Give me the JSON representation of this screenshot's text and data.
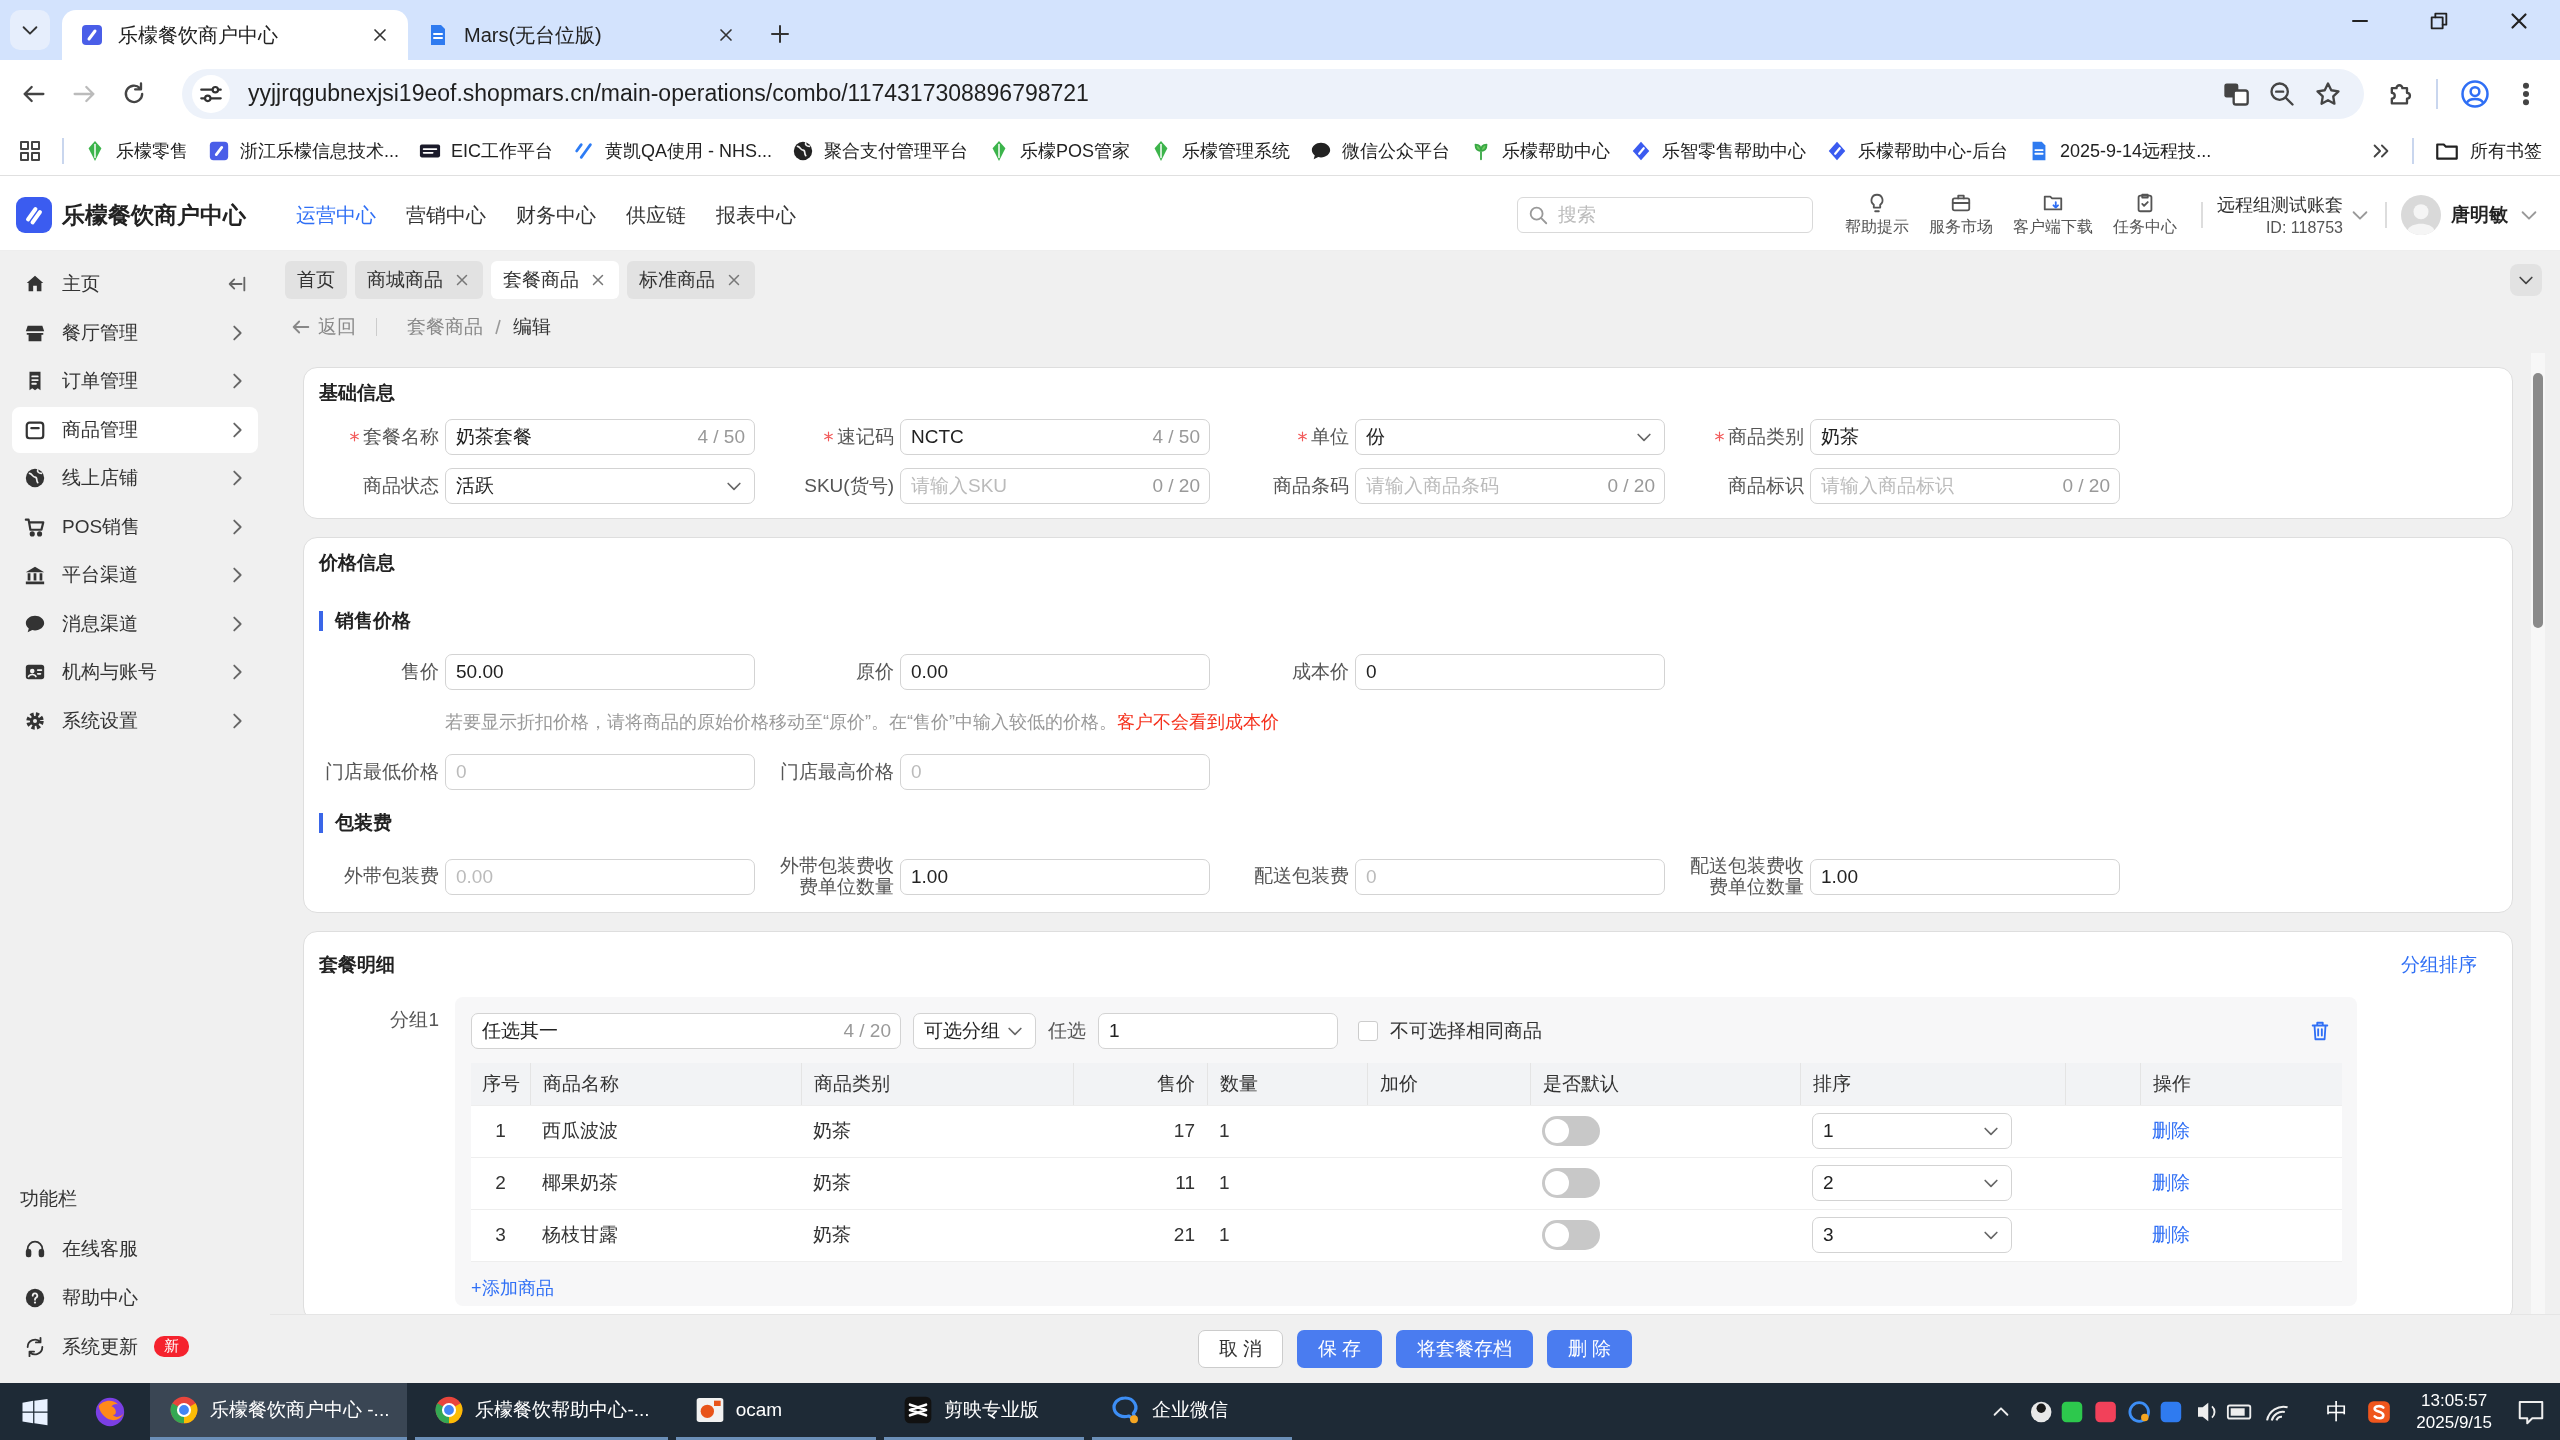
{
  "browser": {
    "tabs": [
      {
        "title": "乐檬餐饮商户中心",
        "selected": true
      },
      {
        "title": "Mars(无台位版)",
        "selected": false
      }
    ],
    "url": "yyjjrqgubnexjsi19eof.shopmars.cn/main-operations/combo/1174317308896798721",
    "bookmarks": [
      {
        "label": "乐檬零售"
      },
      {
        "label": "浙江乐檬信息技术..."
      },
      {
        "label": "EIC工作平台"
      },
      {
        "label": "黄凯QA使用 - NHS..."
      },
      {
        "label": "聚合支付管理平台"
      },
      {
        "label": "乐檬POS管家"
      },
      {
        "label": "乐檬管理系统"
      },
      {
        "label": "微信公众平台"
      },
      {
        "label": "乐檬帮助中心"
      },
      {
        "label": "乐智零售帮助中心"
      },
      {
        "label": "乐檬帮助中心-后台"
      },
      {
        "label": "2025-9-14远程技..."
      }
    ],
    "all_bookmarks": "所有书签"
  },
  "app": {
    "title": "乐檬餐饮商户中心",
    "nav": [
      {
        "label": "运营中心",
        "selected": true
      },
      {
        "label": "营销中心",
        "selected": false
      },
      {
        "label": "财务中心",
        "selected": false
      },
      {
        "label": "供应链",
        "selected": false
      },
      {
        "label": "报表中心",
        "selected": false
      }
    ],
    "search": {
      "placeholder": "搜索"
    },
    "tools": [
      {
        "label": "帮助提示"
      },
      {
        "label": "服务市场"
      },
      {
        "label": "客户端下载"
      },
      {
        "label": "任务中心"
      }
    ],
    "account": {
      "name": "远程组测试账套",
      "id": "ID: 118753"
    },
    "user": "唐明敏"
  },
  "sidebar": {
    "items": [
      {
        "label": "主页",
        "selected": false
      },
      {
        "label": "餐厅管理",
        "selected": false
      },
      {
        "label": "订单管理",
        "selected": false
      },
      {
        "label": "商品管理",
        "selected": true
      },
      {
        "label": "线上店铺",
        "selected": false
      },
      {
        "label": "POS销售",
        "selected": false
      },
      {
        "label": "平台渠道",
        "selected": false
      },
      {
        "label": "消息渠道",
        "selected": false
      },
      {
        "label": "机构与账号",
        "selected": false
      },
      {
        "label": "系统设置",
        "selected": false
      }
    ],
    "section_title": "功能栏",
    "functions": [
      {
        "label": "在线客服"
      },
      {
        "label": "帮助中心"
      },
      {
        "label": "系统更新",
        "badge": "新"
      }
    ]
  },
  "page_tabs": [
    {
      "label": "首页",
      "selected": false,
      "closable": false
    },
    {
      "label": "商城商品",
      "selected": false,
      "closable": true
    },
    {
      "label": "套餐商品",
      "selected": true,
      "closable": true
    },
    {
      "label": "标准商品",
      "selected": false,
      "closable": true
    }
  ],
  "breadcrumb": {
    "back": "返回",
    "path": [
      "套餐商品",
      "编辑"
    ]
  },
  "basic_info": {
    "title": "基础信息",
    "fields": [
      {
        "label": "套餐名称",
        "required": true,
        "kind": "input",
        "value": "奶茶套餐",
        "counter": "4 / 50"
      },
      {
        "label": "速记码",
        "required": true,
        "kind": "input",
        "value": "NCTC",
        "counter": "4 / 50"
      },
      {
        "label": "单位",
        "required": true,
        "kind": "select",
        "value": "份"
      },
      {
        "label": "商品类别",
        "required": true,
        "kind": "input",
        "value": "奶茶"
      },
      {
        "label": "商品状态",
        "required": false,
        "kind": "select",
        "value": "活跃"
      },
      {
        "label": "SKU(货号)",
        "required": false,
        "kind": "input",
        "placeholder": "请输入SKU",
        "counter": "0 / 20"
      },
      {
        "label": "商品条码",
        "required": false,
        "kind": "input",
        "placeholder": "请输入商品条码",
        "counter": "0 / 20"
      },
      {
        "label": "商品标识",
        "required": false,
        "kind": "input",
        "placeholder": "请输入商品标识",
        "counter": "0 / 20"
      }
    ]
  },
  "price_info": {
    "title": "价格信息",
    "sale": {
      "title": "销售价格",
      "fields": [
        {
          "label": "售价",
          "required": false,
          "kind": "input",
          "value": "50.00"
        },
        {
          "label": "原价",
          "required": false,
          "kind": "input",
          "value": "0.00"
        },
        {
          "label": "成本价",
          "required": false,
          "kind": "input",
          "value": "0"
        }
      ],
      "hint": {
        "text": "若要显示折扣价格，请将商品的原始价格移动至“原价”。在“售价”中输入较低的价格。",
        "warning": "客户不会看到成本价"
      },
      "store_fields": [
        {
          "label": "门店最低价格",
          "required": false,
          "kind": "input",
          "placeholder": "0"
        },
        {
          "label": "门店最高价格",
          "required": false,
          "kind": "input",
          "placeholder": "0"
        }
      ]
    },
    "packaging": {
      "title": "包装费",
      "fields": [
        {
          "label": "外带包装费",
          "required": false,
          "kind": "input",
          "placeholder": "0.00"
        },
        {
          "label": "外带包装费收费单位数量",
          "required": false,
          "kind": "input",
          "value": "1.00"
        },
        {
          "label": "配送包装费",
          "required": false,
          "kind": "input",
          "placeholder": "0"
        },
        {
          "label": "配送包装费收费单位数量",
          "required": false,
          "kind": "input",
          "value": "1.00"
        }
      ]
    }
  },
  "combo": {
    "title": "套餐明细",
    "sort_link": "分组排序",
    "groups": [
      {
        "label": "分组1",
        "name": "任选其一",
        "counter": "4 / 20",
        "mode": "可选分组",
        "pick_label": "任选",
        "pick": "1",
        "no_duplicates": {
          "label": "不可选择相同商品",
          "checked": false
        },
        "columns": [
          "序号",
          "商品名称",
          "商品类别",
          "售价",
          "数量",
          "加价",
          "是否默认",
          "排序",
          "操作"
        ],
        "items": [
          {
            "index": "1",
            "name": "西瓜波波",
            "category": "奶茶",
            "price": "17",
            "quantity": "1",
            "default": false,
            "sort": "1",
            "action": "删除"
          },
          {
            "index": "2",
            "name": "椰果奶茶",
            "category": "奶茶",
            "price": "11",
            "quantity": "1",
            "default": false,
            "sort": "2",
            "action": "删除"
          },
          {
            "index": "3",
            "name": "杨枝甘露",
            "category": "奶茶",
            "price": "21",
            "quantity": "1",
            "default": false,
            "sort": "3",
            "action": "删除"
          }
        ],
        "add_link": "+添加商品"
      }
    ]
  },
  "footer": {
    "buttons": [
      {
        "label": "取 消",
        "kind": "secondary"
      },
      {
        "label": "保 存",
        "kind": "primary"
      },
      {
        "label": "将套餐存档",
        "kind": "primary"
      },
      {
        "label": "删 除",
        "kind": "primary"
      }
    ]
  },
  "taskbar": {
    "items": [
      {
        "label": "乐檬餐饮商户中心 -...",
        "selected": true
      },
      {
        "label": "乐檬餐饮帮助中心-...",
        "selected": false
      },
      {
        "label": "ocam",
        "selected": false
      },
      {
        "label": "剪映专业版",
        "selected": false
      },
      {
        "label": "企业微信",
        "selected": false
      }
    ],
    "ime": "中",
    "time": "13:05:57",
    "date": "2025/9/15"
  }
}
